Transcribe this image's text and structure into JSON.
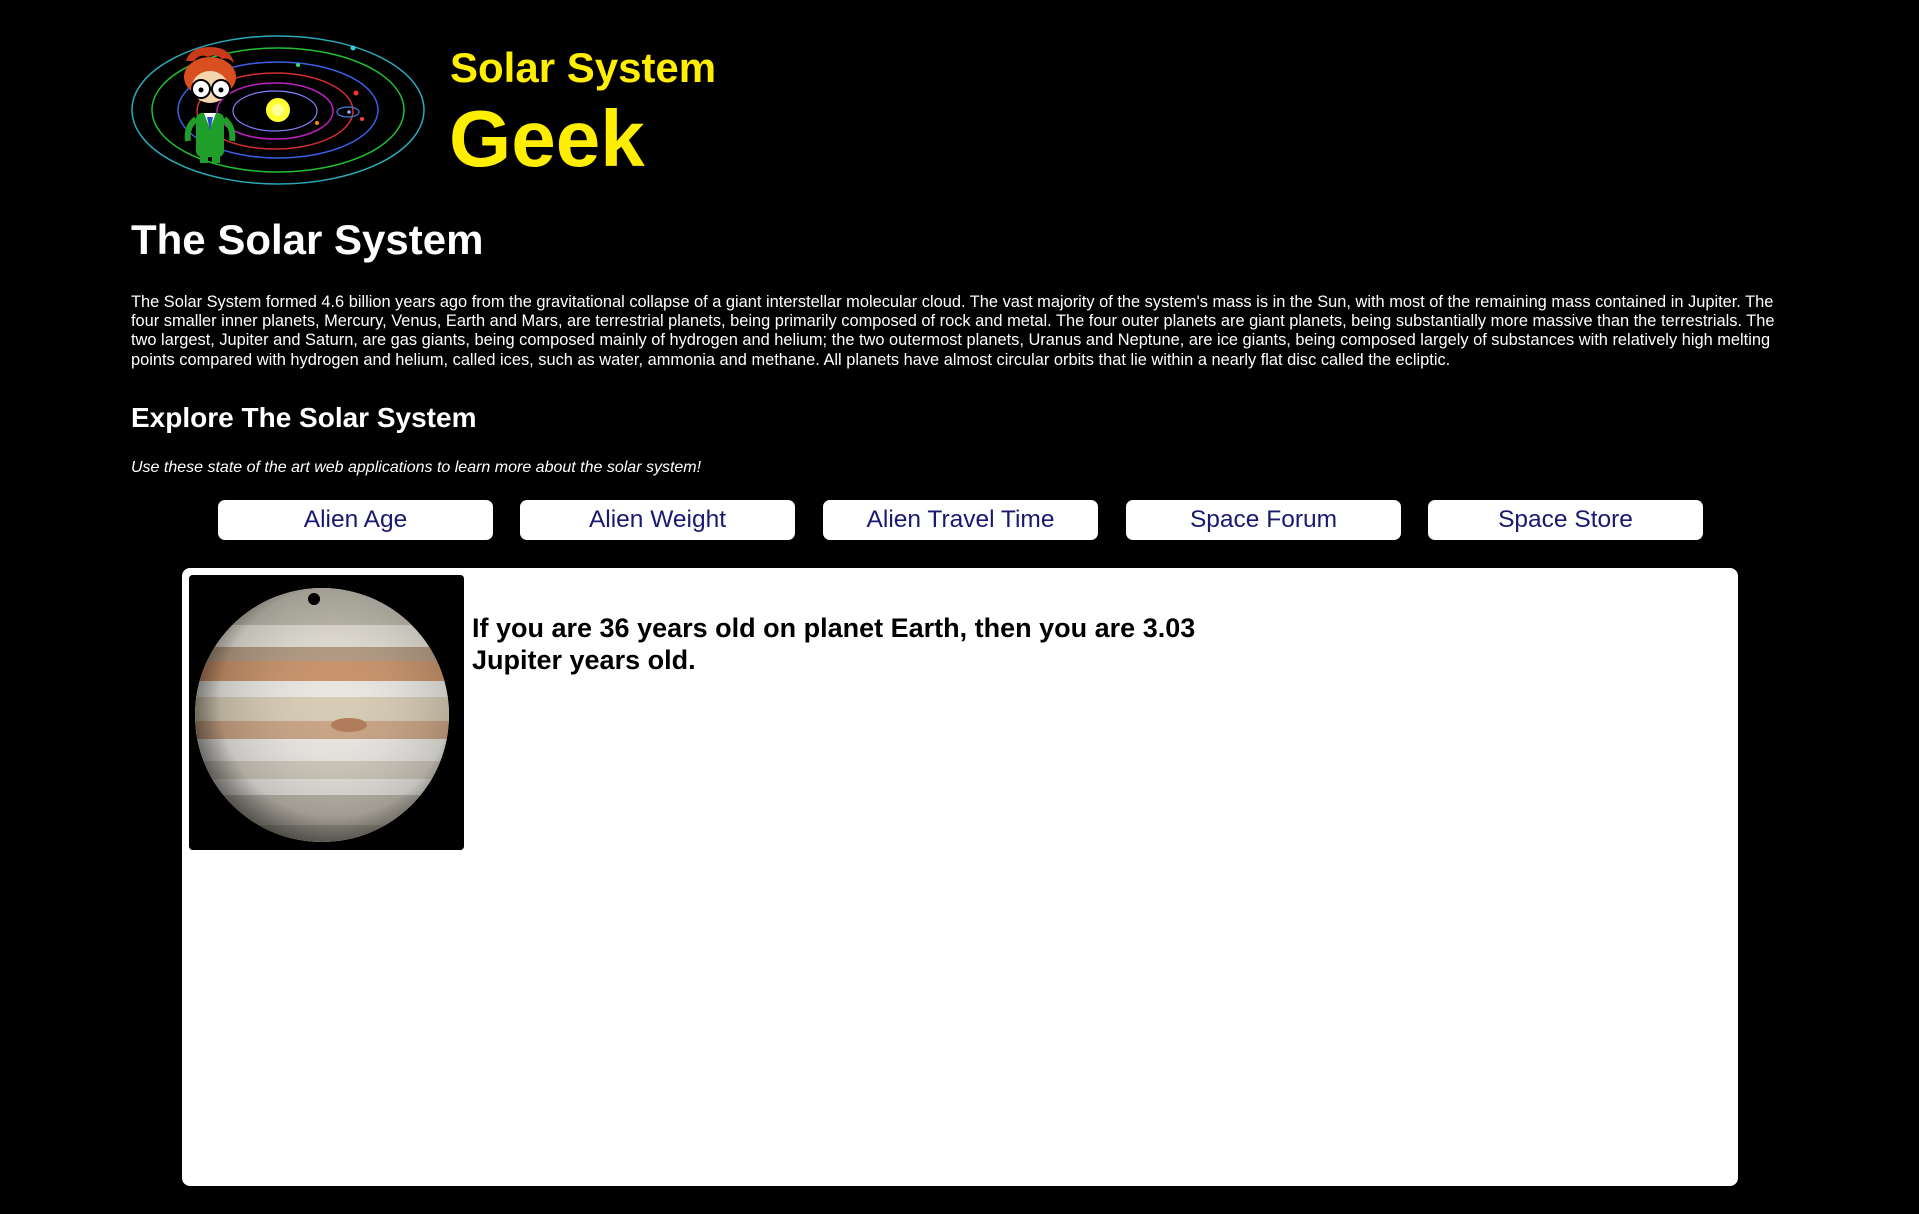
{
  "brand": {
    "title_line1": "Solar System",
    "title_line2": "Geek",
    "logo_icon": "solar-system-geek-logo",
    "accent_color": "#ffee00"
  },
  "page_title": "The Solar System",
  "intro": "The Solar System formed 4.6 billion years ago from the gravitational collapse of a giant interstellar molecular cloud. The vast majority of the system's mass is in the Sun, with most of the remaining mass contained in Jupiter. The four smaller inner planets, Mercury, Venus, Earth and Mars, are terrestrial planets, being primarily composed of rock and metal. The four outer planets are giant planets, being substantially more massive than the terrestrials. The two largest, Jupiter and Saturn, are gas giants, being composed mainly of hydrogen and helium; the two outermost planets, Uranus and Neptune, are ice giants, being composed largely of substances with relatively high melting points compared with hydrogen and helium, called ices, such as water, ammonia and methane. All planets have almost circular orbits that lie within a nearly flat disc called the ecliptic.",
  "explore": {
    "title": "Explore The Solar System",
    "subtitle": "Use these state of the art web applications to learn more about the solar system!"
  },
  "nav": {
    "buttons": [
      {
        "label": "Alien Age"
      },
      {
        "label": "Alien Weight"
      },
      {
        "label": "Alien Travel Time"
      },
      {
        "label": "Space Forum"
      },
      {
        "label": "Space Store"
      }
    ],
    "text_color": "#191970"
  },
  "result": {
    "planet_icon": "jupiter-image",
    "text": "If you are 36 years old on planet Earth, then you are 3.03 Jupiter years old."
  }
}
